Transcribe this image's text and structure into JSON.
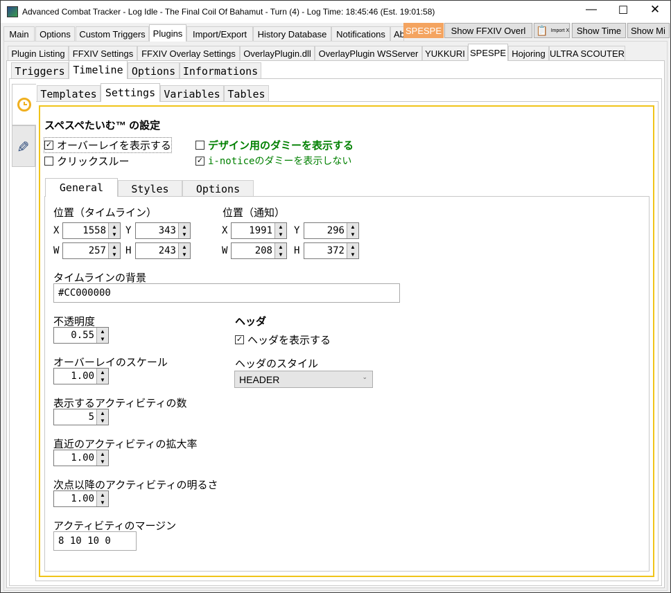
{
  "window": {
    "title": "Advanced Combat Tracker - Log Idle - The Final Coil Of Bahamut - Turn (4) - Log Time: 18:45:46 (Est. 19:01:58)",
    "app_icon": "act-icon"
  },
  "main_tabs": [
    "Main",
    "Options",
    "Custom Triggers",
    "Plugins",
    "Import/Export",
    "History Database",
    "Notifications",
    "Ab"
  ],
  "toolbar": {
    "spespe": "SPESPE",
    "show_overlay": "Show FFXIV Overl",
    "import_xml": "Import XML",
    "show_time": "Show Time",
    "show_mi": "Show Mi",
    "accent": "#f4a460"
  },
  "plugin_tabs": [
    "Plugin Listing",
    "FFXIV Settings",
    "FFXIV Overlay Settings",
    "OverlayPlugin.dll",
    "OverlayPlugin WSServer",
    "YUKKURI",
    "SPESPE",
    "Hojoring",
    "ULTRA SCOUTER"
  ],
  "spespe_tabs": [
    "Triggers",
    "Timeline",
    "Options",
    "Informations"
  ],
  "side_tabs": [
    "clock-icon",
    "pencil-icon"
  ],
  "timeline_tabs": [
    "Templates",
    "Settings",
    "Variables",
    "Tables"
  ],
  "settings": {
    "title": "スペスペたいむ™ の設定",
    "show_overlay": {
      "label": "オーバーレイを表示する",
      "checked": true
    },
    "click_through": {
      "label": "クリックスルー",
      "checked": false
    },
    "show_dummy": {
      "label": "デザイン用のダミーを表示する",
      "checked": false
    },
    "hide_inotice_dummy": {
      "label": "i-noticeのダミーを表示しない",
      "checked": true
    },
    "green": "#008000",
    "border_color": "#f0c419"
  },
  "inner_tabs": [
    "General",
    "Styles",
    "Options"
  ],
  "general": {
    "pos_timeline": "位置（タイムライン）",
    "pos_notice": "位置（通知）",
    "tl": {
      "x": "1558",
      "y": "343",
      "w": "257",
      "h": "243"
    },
    "nt": {
      "x": "1991",
      "y": "296",
      "w": "208",
      "h": "372"
    },
    "axes": {
      "x": "X",
      "y": "Y",
      "w": "W",
      "h": "H"
    },
    "bg_label": "タイムラインの背景",
    "bg_value": "#CC000000",
    "opacity_label": "不透明度",
    "opacity": "0.55",
    "scale_label": "オーバーレイのスケール",
    "scale": "1.00",
    "count_label": "表示するアクティビティの数",
    "count": "5",
    "zoom_label": "直近のアクティビティの拡大率",
    "zoom": "1.00",
    "bright_label": "次点以降のアクティビティの明るさ",
    "bright": "1.00",
    "margin_label": "アクティビティのマージン",
    "margin": "8 10 10 0",
    "header_title": "ヘッダ",
    "show_header": {
      "label": "ヘッダを表示する",
      "checked": true
    },
    "header_style_label": "ヘッダのスタイル",
    "header_style": "HEADER"
  }
}
